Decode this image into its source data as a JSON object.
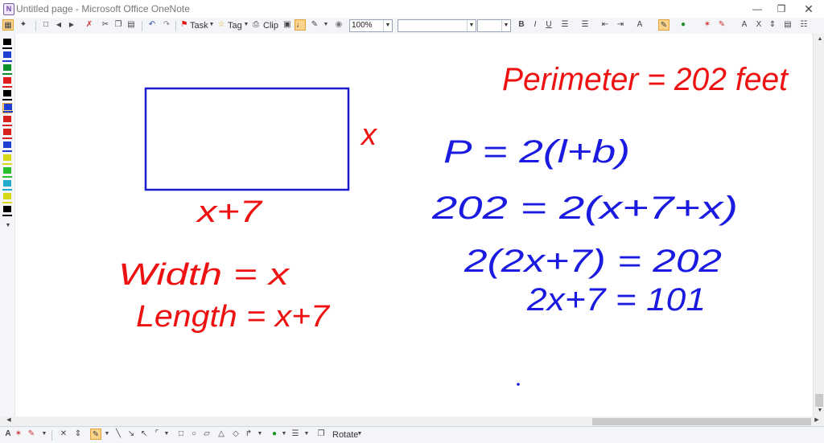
{
  "window": {
    "title": "Untitled page - Microsoft Office OneNote",
    "app_icon": "onenote-icon"
  },
  "toolbar": {
    "task_label": "Task",
    "tag_label": "Tag",
    "clip_label": "Clip",
    "zoom_value": "100%"
  },
  "bottom_toolbar": {
    "rotate_label": "Rotate"
  },
  "ink": {
    "red_color": "#ee1111",
    "blue_color": "#1a1ae0",
    "rectangle_color": "#1c1ccf",
    "perimeter_label": "Perimeter = 202 feet",
    "side_label": "x",
    "bottom_label": "x+7",
    "width_line": "Width = x",
    "length_line": "Length = x+7",
    "equation_1": "P = 2(l+b)",
    "equation_2": "202 = 2(x+7+x)",
    "equation_3": "2(2x+7) = 202",
    "equation_4": "2x+7 = 101"
  },
  "pen_colors": [
    "#000000",
    "#1f3fd0",
    "#0a8f2a",
    "#e01b1b",
    "#000000",
    "#1f3fd0",
    "#d62020",
    "#d62020",
    "#1f3fd0",
    "#d8d81a",
    "#2ac02a",
    "#22aacc",
    "#d8d81a",
    "#000000"
  ]
}
